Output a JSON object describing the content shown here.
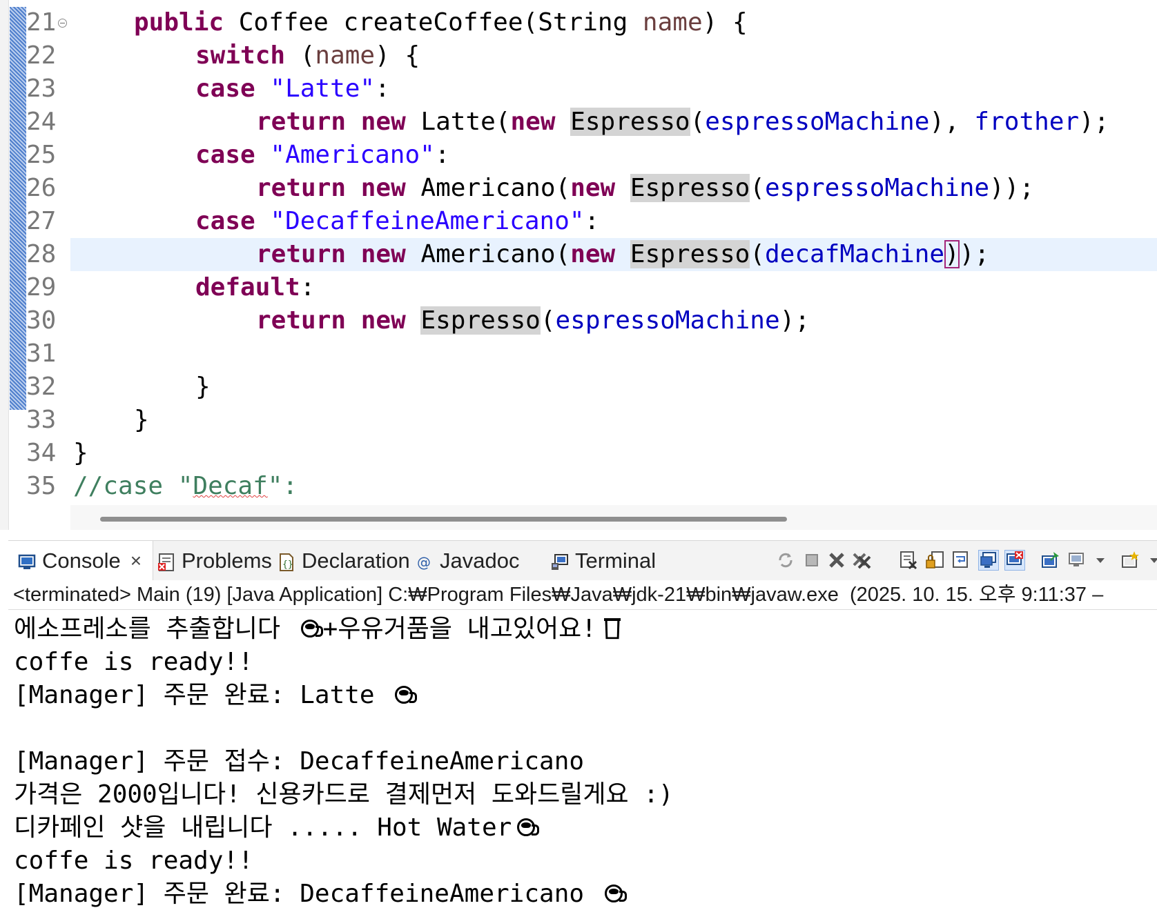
{
  "editor": {
    "lines": [
      {
        "num": "21",
        "fold": true,
        "change": true
      },
      {
        "num": "22",
        "fold": false,
        "change": true
      },
      {
        "num": "23",
        "fold": false,
        "change": true
      },
      {
        "num": "24",
        "fold": false,
        "change": true
      },
      {
        "num": "25",
        "fold": false,
        "change": true
      },
      {
        "num": "26",
        "fold": false,
        "change": true
      },
      {
        "num": "27",
        "fold": false,
        "change": true
      },
      {
        "num": "28",
        "fold": false,
        "change": true,
        "current": true
      },
      {
        "num": "29",
        "fold": false,
        "change": true
      },
      {
        "num": "30",
        "fold": false,
        "change": true
      },
      {
        "num": "31",
        "fold": false,
        "change": true
      },
      {
        "num": "32",
        "fold": false,
        "change": true
      },
      {
        "num": "33",
        "fold": false,
        "change": true
      },
      {
        "num": "34",
        "fold": false,
        "change": false
      },
      {
        "num": "35",
        "fold": false,
        "change": false
      }
    ],
    "code": {
      "l21": {
        "kw1": "public",
        "t1": " Coffee createCoffee(String ",
        "par": "name",
        "t2": ") {"
      },
      "l22": {
        "kw": "switch",
        "t1": " (",
        "par": "name",
        "t2": ") {"
      },
      "l23": {
        "kw": "case",
        "t1": " ",
        "str": "\"Latte\"",
        "t2": ":"
      },
      "l24": {
        "kw1": "return",
        "kw2": "new",
        "t1": " Latte(",
        "kw3": "new",
        "occ": "Espresso",
        "t2": "(",
        "fld1": "espressoMachine",
        "t3": "), ",
        "fld2": "frother",
        "t4": ");"
      },
      "l25": {
        "kw": "case",
        "t1": " ",
        "str": "\"Americano\"",
        "t2": ":"
      },
      "l26": {
        "kw1": "return",
        "kw2": "new",
        "t1": " Americano(",
        "kw3": "new",
        "occ": "Espresso",
        "t2": "(",
        "fld": "espressoMachine",
        "t3": "));"
      },
      "l27": {
        "kw": "case",
        "t1": " ",
        "str": "\"DecaffeineAmericano\"",
        "t2": ":"
      },
      "l28": {
        "kw1": "return",
        "kw2": "new",
        "t1": " Americano(",
        "kw3": "new",
        "occ": "Espresso",
        "t2": "(",
        "fld": "decafMachine",
        "br": ")",
        "t3": ");"
      },
      "l29": {
        "kw": "default",
        "t1": ":"
      },
      "l30": {
        "kw1": "return",
        "kw2": "new",
        "occ": "Espresso",
        "t1": "(",
        "fld": "espressoMachine",
        "t2": ");"
      },
      "l32": {
        "t1": "}"
      },
      "l33": {
        "t1": "}"
      },
      "l34": {
        "t1": "}"
      },
      "l35": {
        "c1": "//case \"",
        "c2": "Decaf",
        "c3": "\":"
      }
    }
  },
  "views": {
    "tabs": [
      {
        "label": "Console",
        "active": true,
        "close": "×"
      },
      {
        "label": "Problems"
      },
      {
        "label": "Declaration"
      },
      {
        "label": "Javadoc"
      },
      {
        "label": "Terminal"
      }
    ],
    "status_text": "<terminated> Main (19) [Java Application] C:₩Program Files₩Java₩jdk-21₩bin₩javaw.exe  (2025. 10. 15. 오후 9:11:37 –",
    "console_lines": [
      {
        "text": "에소프레소를 추출합니다 ",
        "tail": "+우유거품을 내고있어요!",
        "icon_after_text": "cup",
        "icon_end": "glass"
      },
      {
        "text": "coffe is ready!!"
      },
      {
        "text": "[Manager] 주문 완료: Latte ",
        "icon_end": "cup"
      },
      {
        "text": ""
      },
      {
        "text": "[Manager] 주문 접수: DecaffeineAmericano"
      },
      {
        "text": "가격은 2000입니다! 신용카드로 결제먼저 도와드릴게요 :)"
      },
      {
        "text": "디카페인 샷을 내립니다 ..... Hot Water",
        "icon_end": "cup"
      },
      {
        "text": "coffe is ready!!"
      },
      {
        "text": "[Manager] 주문 완료: DecaffeineAmericano ",
        "icon_end": "cup"
      }
    ]
  },
  "colors": {
    "keyword": "#7f0055",
    "string": "#2a00ff",
    "field": "#0000c0",
    "parameter": "#6a3e3e",
    "comment": "#3f7f5f",
    "current_line": "#e8f2fe",
    "occurrence": "#d4d4d4"
  }
}
